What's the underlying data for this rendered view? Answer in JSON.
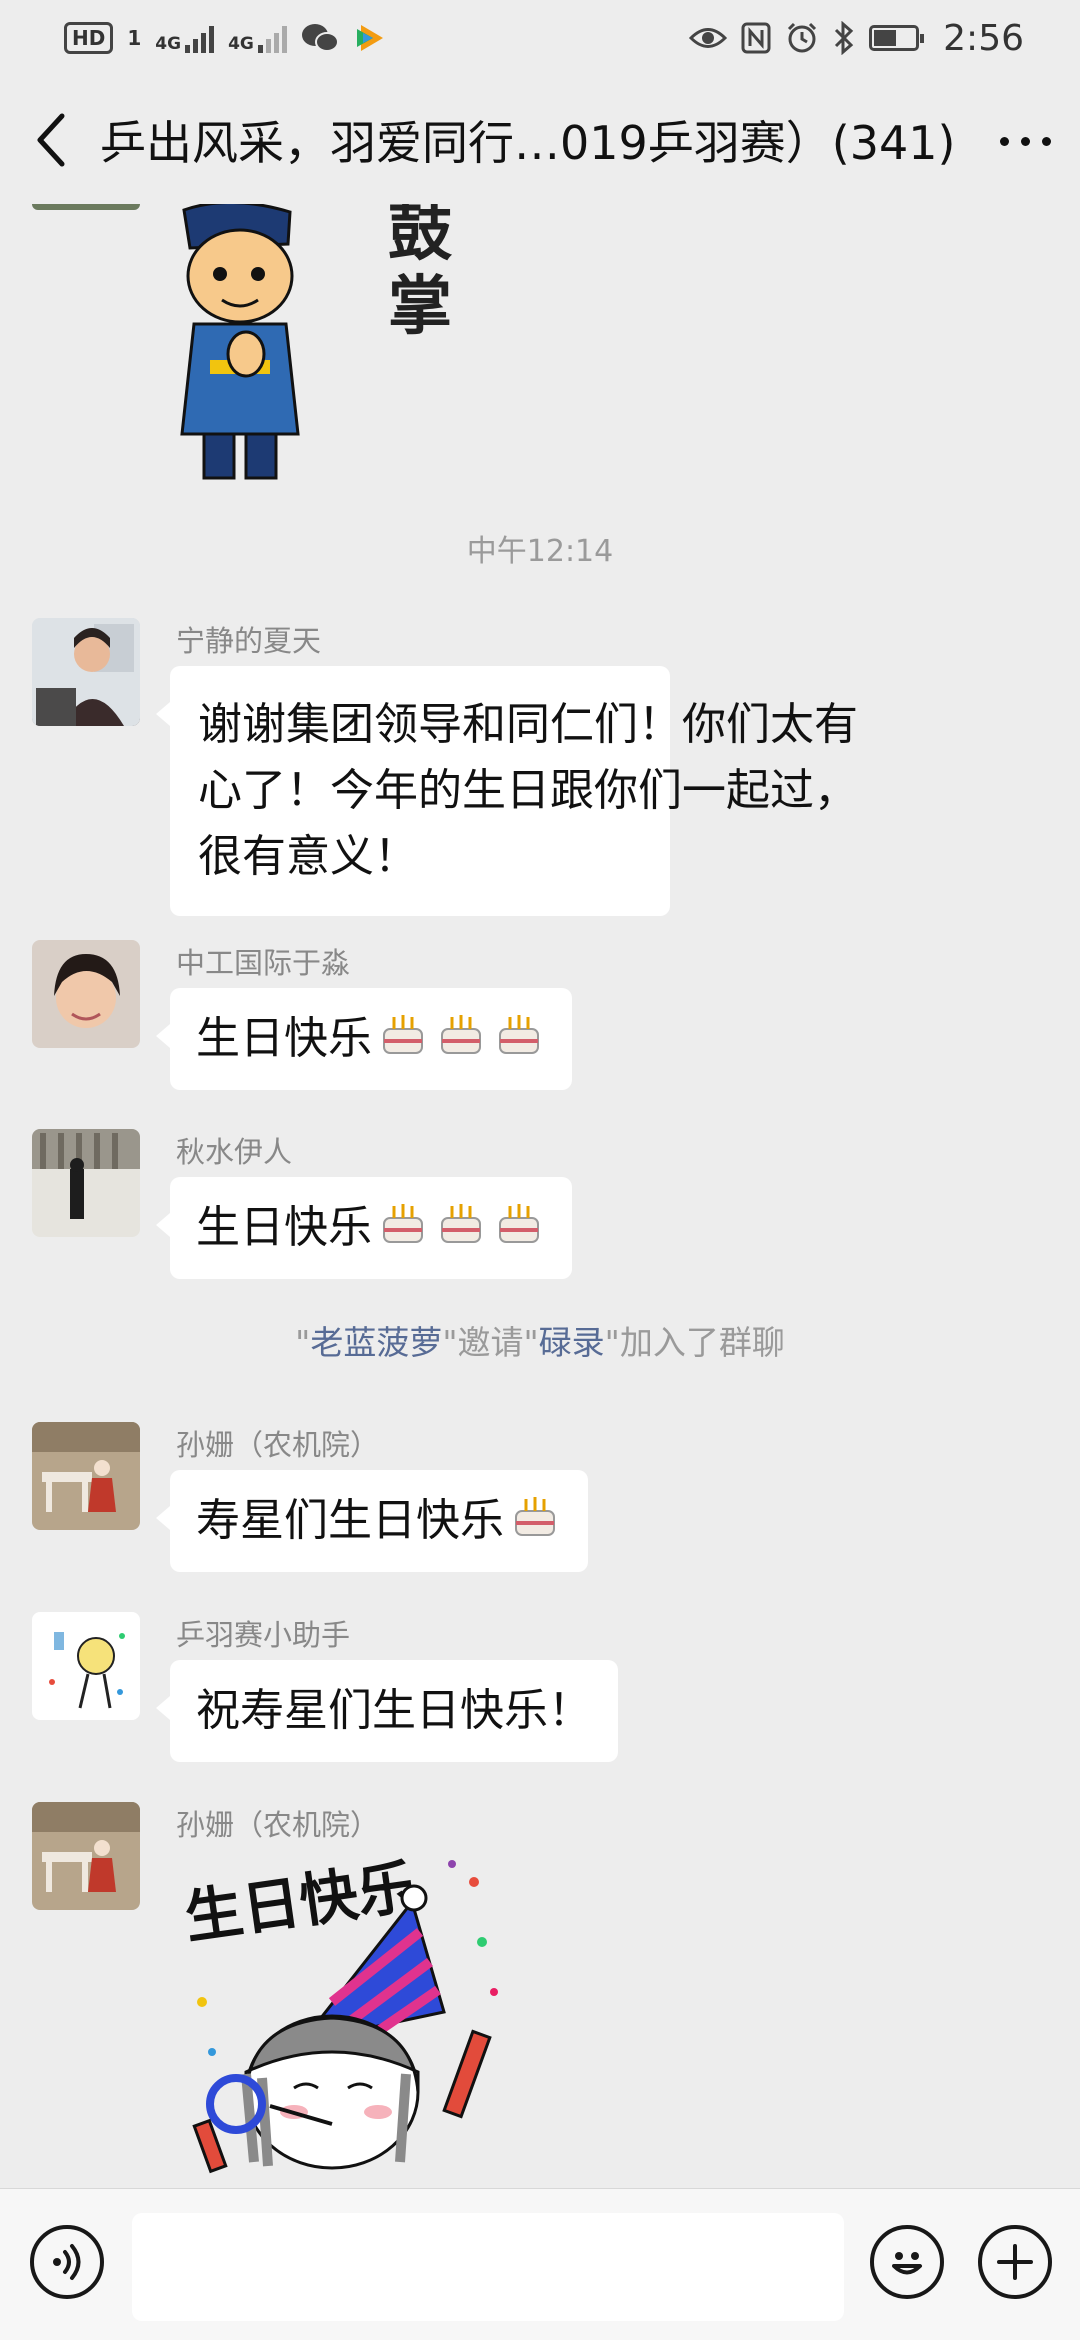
{
  "status_bar": {
    "hd": "HD",
    "hd_sub": "1",
    "net1": "4G",
    "net2": "4G",
    "time": "2:56"
  },
  "header": {
    "title": "乒出风采，羽爱同行…019乒羽赛）(341)"
  },
  "chat": {
    "sticker_top": {
      "text": "鼓掌"
    },
    "time_label": "中午12:14",
    "messages": [
      {
        "sender": "宁静的夏天",
        "line1": "谢谢集团领导和同仁们！你们太有",
        "line2": "心了！今年的生日跟你们一起过，",
        "line3": "很有意义！"
      },
      {
        "sender": "中工国际于淼",
        "text": "生日快乐"
      },
      {
        "sender": "秋水伊人",
        "text": "生日快乐"
      },
      {
        "sender": "孙姗（农机院）",
        "text": "寿星们生日快乐"
      },
      {
        "sender": "乒羽赛小助手",
        "text": "祝寿星们生日快乐！"
      },
      {
        "sender": "孙姗（农机院）",
        "sticker_text": "生日快乐"
      }
    ],
    "system_notice": {
      "q1": "\"",
      "inviter": "老蓝菠萝",
      "mid": "\"邀请\"",
      "invitee": "碌录",
      "tail": "\"加入了群聊"
    }
  },
  "colors": {
    "background": "#ededed",
    "bubble": "#ffffff",
    "link_name": "#576b95",
    "meta_text": "#9a9a9a"
  },
  "icons": [
    "back-arrow-icon",
    "more-dots-icon",
    "voice-icon",
    "emoji-icon",
    "plus-icon",
    "cake-emoji-icon",
    "eye-icon",
    "nfc-icon",
    "alarm-icon",
    "bluetooth-icon",
    "battery-icon",
    "wechat-icon",
    "video-app-icon"
  ]
}
